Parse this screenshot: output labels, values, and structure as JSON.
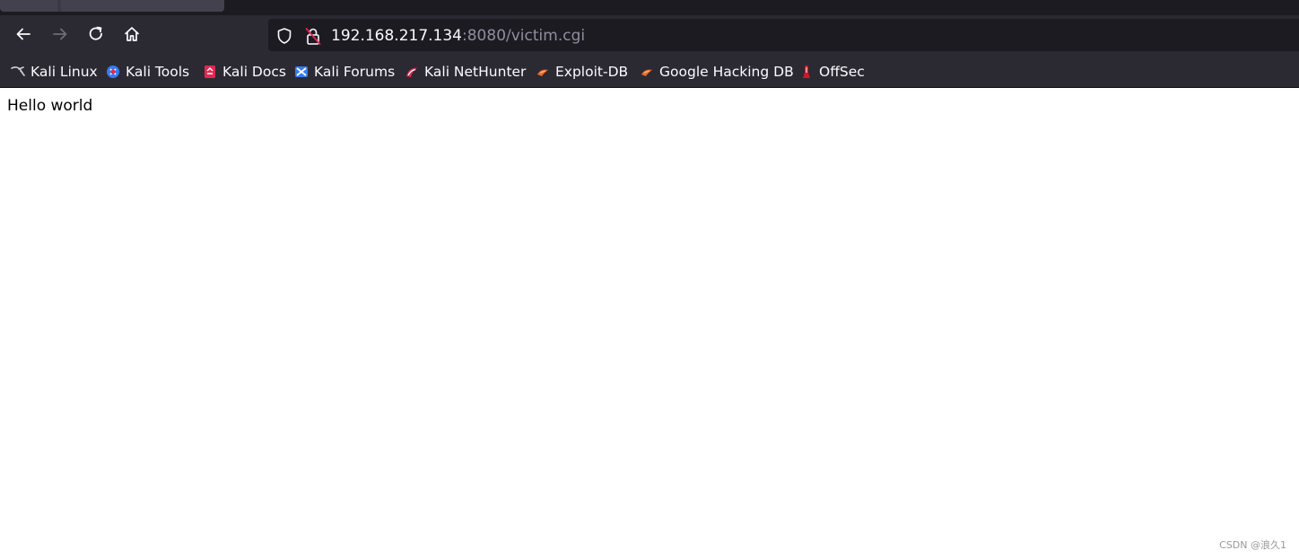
{
  "browser": {
    "nav": {
      "back_icon": "back-arrow-icon",
      "forward_icon": "forward-arrow-icon",
      "reload_icon": "reload-icon",
      "home_icon": "home-icon"
    },
    "urlbar": {
      "host": "192.168.217.134",
      "rest": ":8080/victim.cgi",
      "shield_icon": "tracking-protection-shield-icon",
      "lock_icon": "insecure-lock-icon"
    },
    "bookmarks": [
      {
        "label": "Kali Linux",
        "icon": "kali-dragon-icon"
      },
      {
        "label": "Kali Tools",
        "icon": "kali-tools-icon"
      },
      {
        "label": "Kali Docs",
        "icon": "kali-docs-icon"
      },
      {
        "label": "Kali Forums",
        "icon": "kali-forums-icon"
      },
      {
        "label": "Kali NetHunter",
        "icon": "nethunter-icon"
      },
      {
        "label": "Exploit-DB",
        "icon": "exploit-db-icon"
      },
      {
        "label": "Google Hacking DB",
        "icon": "ghdb-icon"
      },
      {
        "label": "OffSec",
        "icon": "offsec-icon"
      }
    ]
  },
  "page": {
    "body_text": "Hello world"
  },
  "watermark": "CSDN @浪久1",
  "colors": {
    "toolbar_bg": "#2b2a33",
    "tabstrip_bg": "#1c1b22",
    "urlbar_bg": "#1c1b22",
    "text_light": "#fbfbfe",
    "url_muted": "#8f8f9d"
  }
}
